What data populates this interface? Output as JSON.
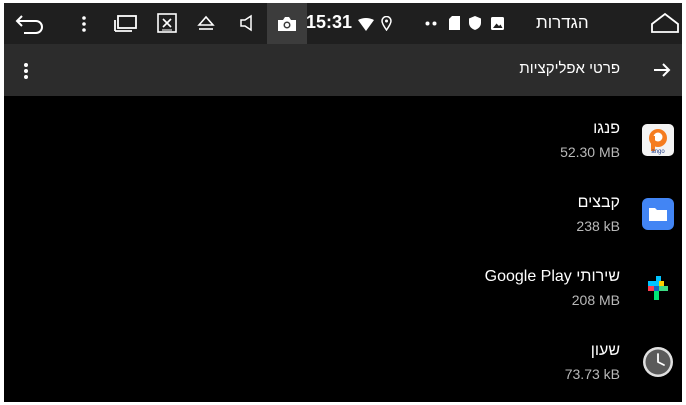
{
  "status_bar": {
    "time": "15:31",
    "title": "הגדרות",
    "icons": [
      "back-icon",
      "more-vert-icon",
      "window-icon",
      "close-box-icon",
      "eject-icon",
      "volume-icon",
      "camera-icon",
      "wifi-icon",
      "location-icon",
      "dots-icon",
      "sd-card-icon",
      "shield-icon",
      "image-icon",
      "home-icon"
    ]
  },
  "app_bar": {
    "title": "פרטי אפליקציות"
  },
  "apps": [
    {
      "name": "פנגו",
      "size": "52.30 MB",
      "icon": "pango-icon"
    },
    {
      "name": "קבצים",
      "size": "238 kB",
      "icon": "files-icon"
    },
    {
      "name": "שירותי Google Play",
      "size": "208 MB",
      "icon": "google-play-services-icon"
    },
    {
      "name": "שעון",
      "size": "73.73 kB",
      "icon": "clock-icon"
    }
  ],
  "colors": {
    "background": "#000000",
    "status_bar": "#1f1f1f",
    "app_bar": "#2c2c2c",
    "secondary_text": "#b9b9b9",
    "files_blue": "#4285f4",
    "pango_orange": "#f57c1f"
  }
}
